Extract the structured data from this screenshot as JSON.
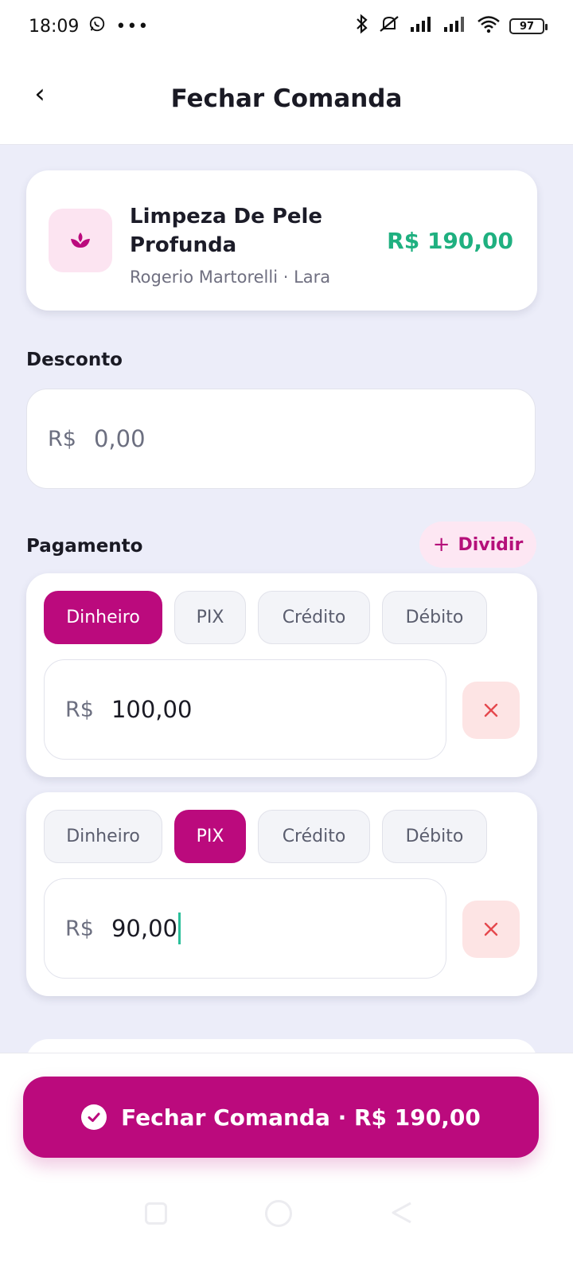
{
  "status_bar": {
    "time": "18:09",
    "battery": "97"
  },
  "header": {
    "title": "Fechar Comanda",
    "back_glyph": "‹"
  },
  "service": {
    "name": "Limpeza De Pele Profunda",
    "subtitle": "Rogerio Martorelli · Lara",
    "price": "R$ 190,00",
    "icon": "lotus-icon",
    "price_color": "#1FB080"
  },
  "discount": {
    "label": "Desconto",
    "currency": "R$",
    "placeholder": "0,00"
  },
  "payment": {
    "label": "Pagamento",
    "split_label": "Dividir",
    "entries": [
      {
        "methods": [
          "Dinheiro",
          "PIX",
          "Crédito",
          "Débito"
        ],
        "selected": "Dinheiro",
        "currency": "R$",
        "value": "100,00"
      },
      {
        "methods": [
          "Dinheiro",
          "PIX",
          "Crédito",
          "Débito"
        ],
        "selected": "PIX",
        "currency": "R$",
        "value": "90,00"
      }
    ]
  },
  "submit": {
    "label": "Fechar Comanda · R$ 190,00"
  },
  "colors": {
    "accent": "#BB0A7D",
    "accent_soft": "#FDE7F3",
    "success": "#1FB080",
    "danger": "#E5484D",
    "background": "#ECEDF9"
  }
}
